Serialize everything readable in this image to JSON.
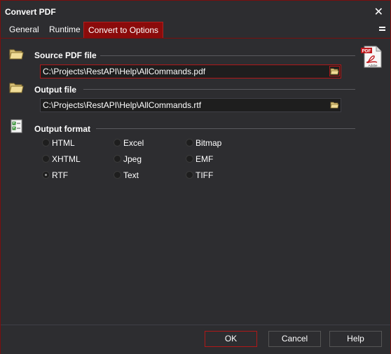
{
  "window": {
    "title": "Convert PDF"
  },
  "tabs": [
    {
      "label": "General"
    },
    {
      "label": "Runtime"
    },
    {
      "label": "Convert to Options"
    }
  ],
  "sections": {
    "source": {
      "label": "Source PDF file",
      "value": "C:\\Projects\\RestAPI\\Help\\AllCommands.pdf",
      "icon": "folder-icon"
    },
    "output": {
      "label": "Output file",
      "value": "C:\\Projects\\RestAPI\\Help\\AllCommands.rtf",
      "icon": "folder-icon"
    },
    "format": {
      "label": "Output format",
      "icon": "checklist-icon",
      "options": [
        {
          "label": "HTML",
          "checked": false
        },
        {
          "label": "Excel",
          "checked": false
        },
        {
          "label": "Bitmap",
          "checked": false
        },
        {
          "label": "XHTML",
          "checked": false
        },
        {
          "label": "Jpeg",
          "checked": false
        },
        {
          "label": "EMF",
          "checked": false
        },
        {
          "label": "RTF",
          "checked": true
        },
        {
          "label": "Text",
          "checked": false
        },
        {
          "label": "TIFF",
          "checked": false
        }
      ]
    }
  },
  "pdf_icon": {
    "badge": "PDF",
    "caption": "Adobe"
  },
  "buttons": {
    "ok": "OK",
    "cancel": "Cancel",
    "help": "Help"
  },
  "colors": {
    "accent": "#8b0b0b",
    "background": "#2d2d30",
    "field": "#1e1e1e"
  }
}
